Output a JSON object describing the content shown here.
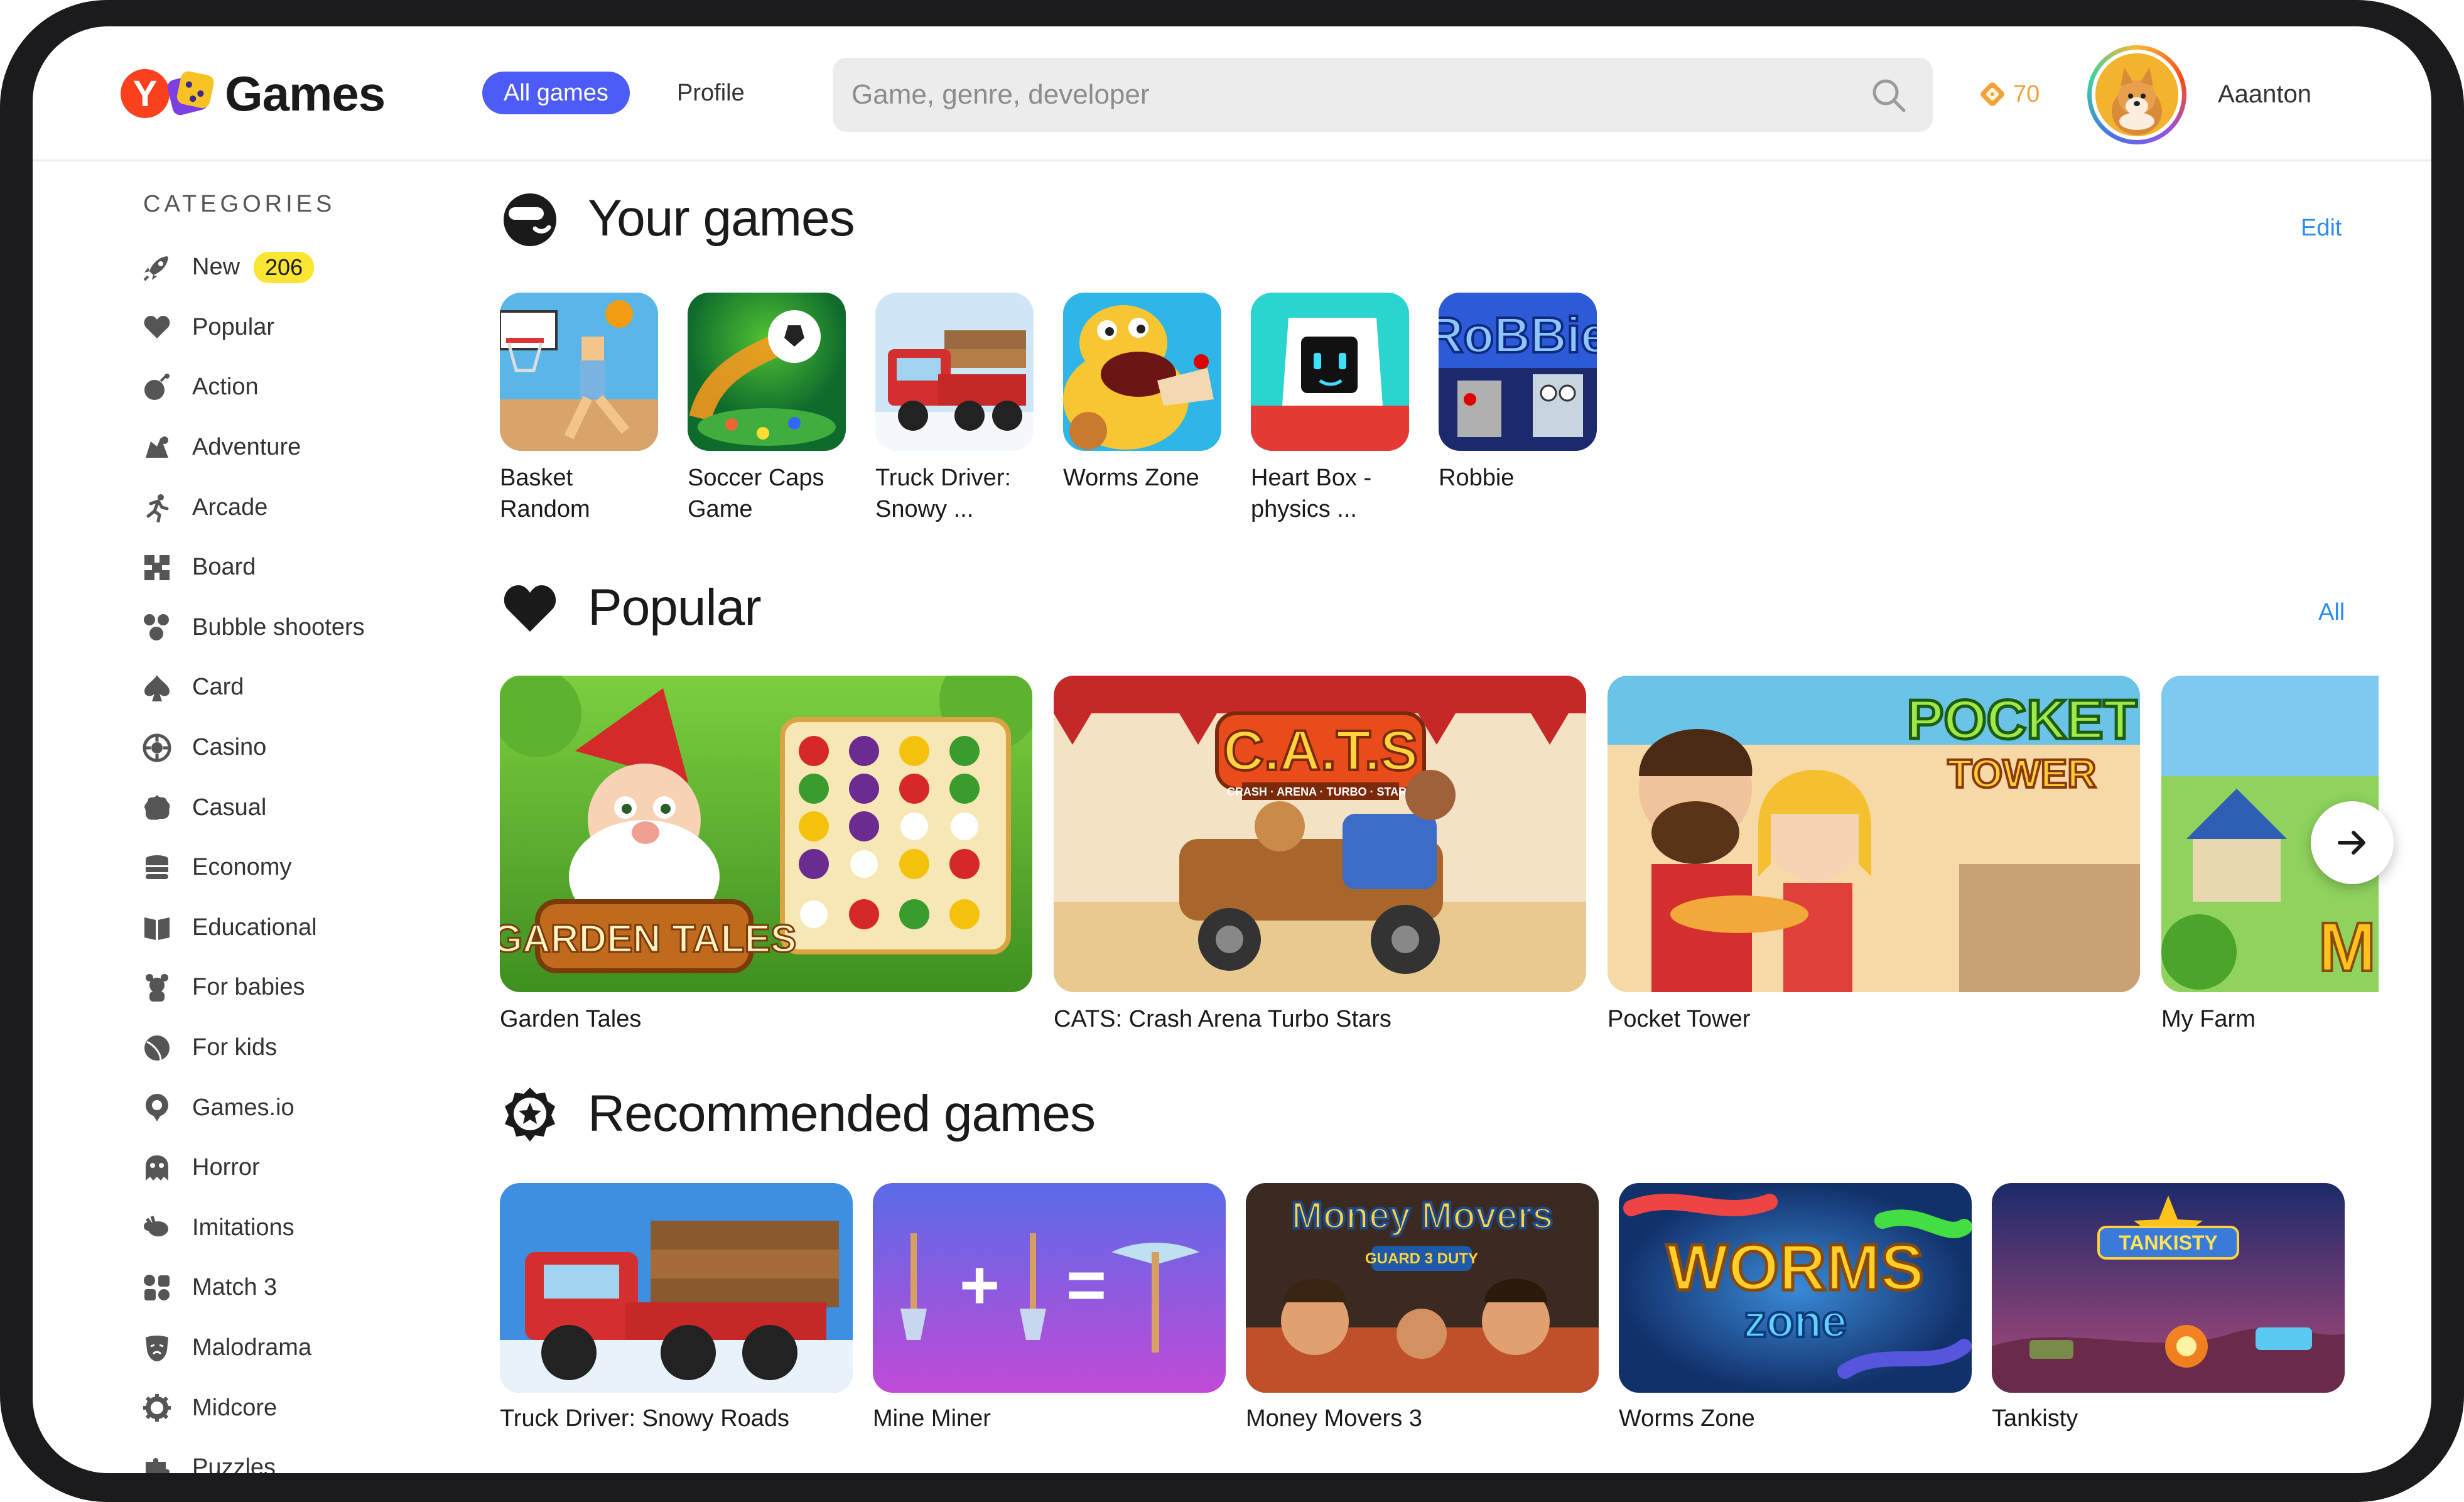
{
  "header": {
    "logo_text": "Games",
    "logo_letter": "Y",
    "nav_all_games": "All games",
    "nav_profile": "Profile",
    "search_placeholder": "Game, genre, developer",
    "coins": "70",
    "username": "Aaanton",
    "accent_color": "#4d5cf6"
  },
  "sidebar": {
    "title": "CATEGORIES",
    "items": [
      {
        "label": "New",
        "badge": "206",
        "icon": "rocket-icon"
      },
      {
        "label": "Popular",
        "icon": "heart-icon"
      },
      {
        "label": "Action",
        "icon": "bomb-icon"
      },
      {
        "label": "Adventure",
        "icon": "compass-icon"
      },
      {
        "label": "Arcade",
        "icon": "runner-icon"
      },
      {
        "label": "Board",
        "icon": "board-icon"
      },
      {
        "label": "Bubble shooters",
        "icon": "bubbles-icon"
      },
      {
        "label": "Card",
        "icon": "spade-icon"
      },
      {
        "label": "Casino",
        "icon": "chip-icon"
      },
      {
        "label": "Casual",
        "icon": "cookie-icon"
      },
      {
        "label": "Economy",
        "icon": "coins-icon"
      },
      {
        "label": "Educational",
        "icon": "book-icon"
      },
      {
        "label": "For babies",
        "icon": "bear-icon"
      },
      {
        "label": "For kids",
        "icon": "ball-icon"
      },
      {
        "label": "Games.io",
        "icon": "io-icon"
      },
      {
        "label": "Horror",
        "icon": "ghost-icon"
      },
      {
        "label": "Imitations",
        "icon": "goat-icon"
      },
      {
        "label": "Match 3",
        "icon": "match-icon"
      },
      {
        "label": "Malodrama",
        "icon": "drama-icon"
      },
      {
        "label": "Midcore",
        "icon": "gear-icon"
      },
      {
        "label": "Puzzles",
        "icon": "puzzle-icon"
      }
    ]
  },
  "your_games": {
    "title": "Your games",
    "action": "Edit",
    "items": [
      {
        "name": "Basket Random"
      },
      {
        "name": "Soccer Caps Game"
      },
      {
        "name": "Truck Driver: Snowy ..."
      },
      {
        "name": "Worms Zone"
      },
      {
        "name": "Heart Box - physics ..."
      },
      {
        "name": "Robbie"
      }
    ]
  },
  "popular": {
    "title": "Popular",
    "action": "All",
    "items": [
      {
        "name": "Garden Tales",
        "art_text": "GARDEN TALES"
      },
      {
        "name": "CATS: Crash Arena Turbo Stars",
        "art_text": "C.A.T.S",
        "art_sub": "CRASH · ARENA · TURBO · STARS"
      },
      {
        "name": "Pocket Tower",
        "art_text": "POCKET",
        "art_text2": "TOWER"
      },
      {
        "name": "My Farm"
      }
    ]
  },
  "recommended": {
    "title": "Recommended games",
    "items": [
      {
        "name": "Truck Driver: Snowy Roads"
      },
      {
        "name": "Mine Miner"
      },
      {
        "name": "Money Movers 3",
        "art_text": "Money Movers",
        "art_sub": "GUARD 3 DUTY"
      },
      {
        "name": "Worms Zone",
        "art_text": "WORMS",
        "art_sub": "zone"
      },
      {
        "name": "Tankisty",
        "art_text": "TANKISTY"
      }
    ]
  }
}
